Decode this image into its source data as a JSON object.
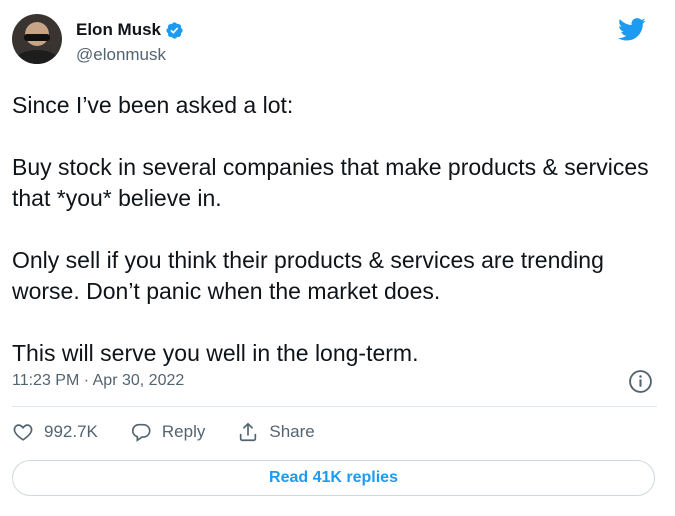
{
  "colors": {
    "accent": "#1d9bf0",
    "muted": "#536471",
    "text": "#0f1419",
    "border": "#cfd9de"
  },
  "author": {
    "name": "Elon Musk",
    "handle": "@elonmusk",
    "verified_icon": "verified-badge-icon"
  },
  "logo_icon": "twitter-bird-icon",
  "tweet": {
    "text": "Since I’ve been asked a lot:\n\nBuy stock in several companies that make products & services that *you* believe in.\n\nOnly sell if you think their products & services are trending worse. Don’t panic when the market does.\n\nThis will serve you well in the long-term.",
    "timestamp": "11:23 PM · Apr 30, 2022"
  },
  "actions": {
    "like_count": "992.7K",
    "reply_label": "Reply",
    "share_label": "Share"
  },
  "read_replies_label": "Read 41K replies"
}
